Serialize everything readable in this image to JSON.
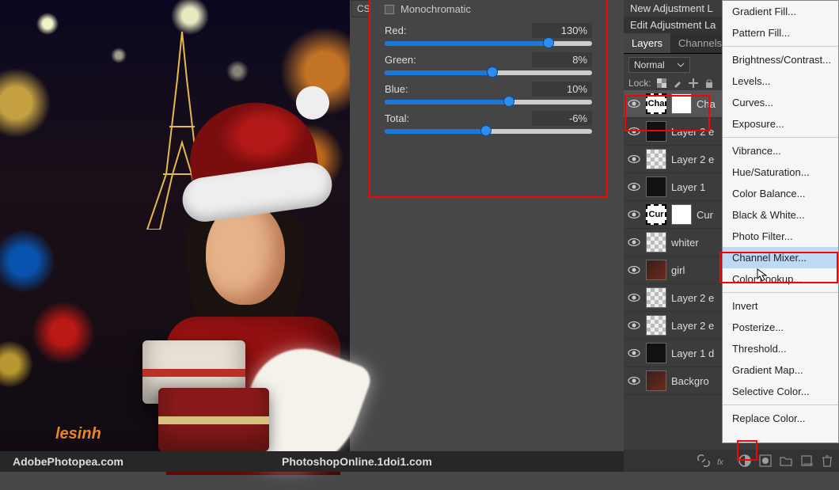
{
  "canvas": {
    "watermark": "lesinh",
    "css_label": "CSS"
  },
  "channel_mixer": {
    "monochromatic": {
      "label": "Monochromatic",
      "checked": false
    },
    "sliders": [
      {
        "label": "Red:",
        "value": "130%",
        "pct": 79
      },
      {
        "label": "Green:",
        "value": "8%",
        "pct": 52
      },
      {
        "label": "Blue:",
        "value": "10%",
        "pct": 60
      },
      {
        "label": "Total:",
        "value": "-6%",
        "pct": 49
      }
    ]
  },
  "right_header": {
    "line1": "New Adjustment L",
    "line2": "Edit Adjustment La"
  },
  "tabs": {
    "layers": "Layers",
    "channels": "Channels"
  },
  "blend_mode": "Normal",
  "lock_label": "Lock:",
  "layers": [
    {
      "name": "Cha",
      "thumb": "txt",
      "mask": true,
      "sel": true,
      "eye": true
    },
    {
      "name": "Layer 2 e",
      "thumb": "dark",
      "eye": true
    },
    {
      "name": "Layer 2 e",
      "thumb": "chk",
      "eye": true
    },
    {
      "name": "Layer 1",
      "thumb": "dark",
      "eye": true
    },
    {
      "name": "Cur",
      "thumb": "txt",
      "mask": true,
      "eye": true
    },
    {
      "name": "whiter",
      "thumb": "chk",
      "eye": true
    },
    {
      "name": "girl",
      "thumb": "img",
      "eye": true
    },
    {
      "name": "Layer 2 e",
      "thumb": "chk",
      "eye": true
    },
    {
      "name": "Layer 2 e",
      "thumb": "chk",
      "eye": true
    },
    {
      "name": "Layer 1 d",
      "thumb": "dark",
      "eye": true
    },
    {
      "name": "Backgro",
      "thumb": "img",
      "eye": true
    }
  ],
  "menu": [
    "Gradient Fill...",
    "Pattern Fill...",
    "",
    "Brightness/Contrast...",
    "Levels...",
    "Curves...",
    "Exposure...",
    "",
    "Vibrance...",
    "Hue/Saturation...",
    "Color Balance...",
    "Black & White...",
    "Photo Filter...",
    "Channel Mixer...",
    "Color Lookup...",
    "",
    "Invert",
    "Posterize...",
    "Threshold...",
    "Gradient Map...",
    "Selective Color...",
    "",
    "Replace Color..."
  ],
  "menu_selected": 13,
  "footer": {
    "left": "AdobePhotopea.com",
    "right": "PhotoshopOnline.1doi1.com"
  }
}
